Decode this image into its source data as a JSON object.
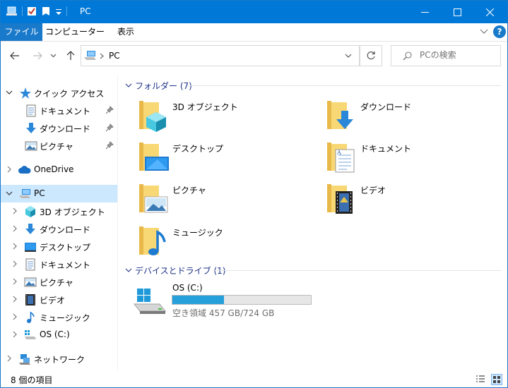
{
  "window": {
    "title": "PC",
    "minimize_label": "—",
    "maximize_label": "☐",
    "close_label": "✕"
  },
  "ribbon": {
    "tabs": [
      "ファイル",
      "コンピューター",
      "表示"
    ],
    "help_label": "?"
  },
  "address": {
    "path": "PC",
    "search_placeholder": "PCの検索"
  },
  "nav": {
    "quick_access": "クイック アクセス",
    "quick_items": [
      "ドキュメント",
      "ダウンロード",
      "ピクチャ"
    ],
    "onedrive": "OneDrive",
    "pc": "PC",
    "pc_items": [
      "3D オブジェクト",
      "ダウンロード",
      "デスクトップ",
      "ドキュメント",
      "ピクチャ",
      "ビデオ",
      "ミュージック",
      "OS (C:)"
    ],
    "network": "ネットワーク"
  },
  "folders": {
    "header": "フォルダー (7)",
    "items": [
      "3D オブジェクト",
      "ダウンロード",
      "デスクトップ",
      "ドキュメント",
      "ピクチャ",
      "ビデオ",
      "ミュージック"
    ]
  },
  "devices": {
    "header": "デバイスとドライブ (1)",
    "drive_name": "OS (C:)",
    "used_fraction": 0.37,
    "free_text": "空き領域 457 GB/724 GB"
  },
  "status": {
    "item_count": "8 個の項目"
  },
  "colors": {
    "titlebar": "#0078d7",
    "selection": "#cce8ff",
    "group_header": "#1e3287",
    "drive_bar": "#26a0da"
  }
}
